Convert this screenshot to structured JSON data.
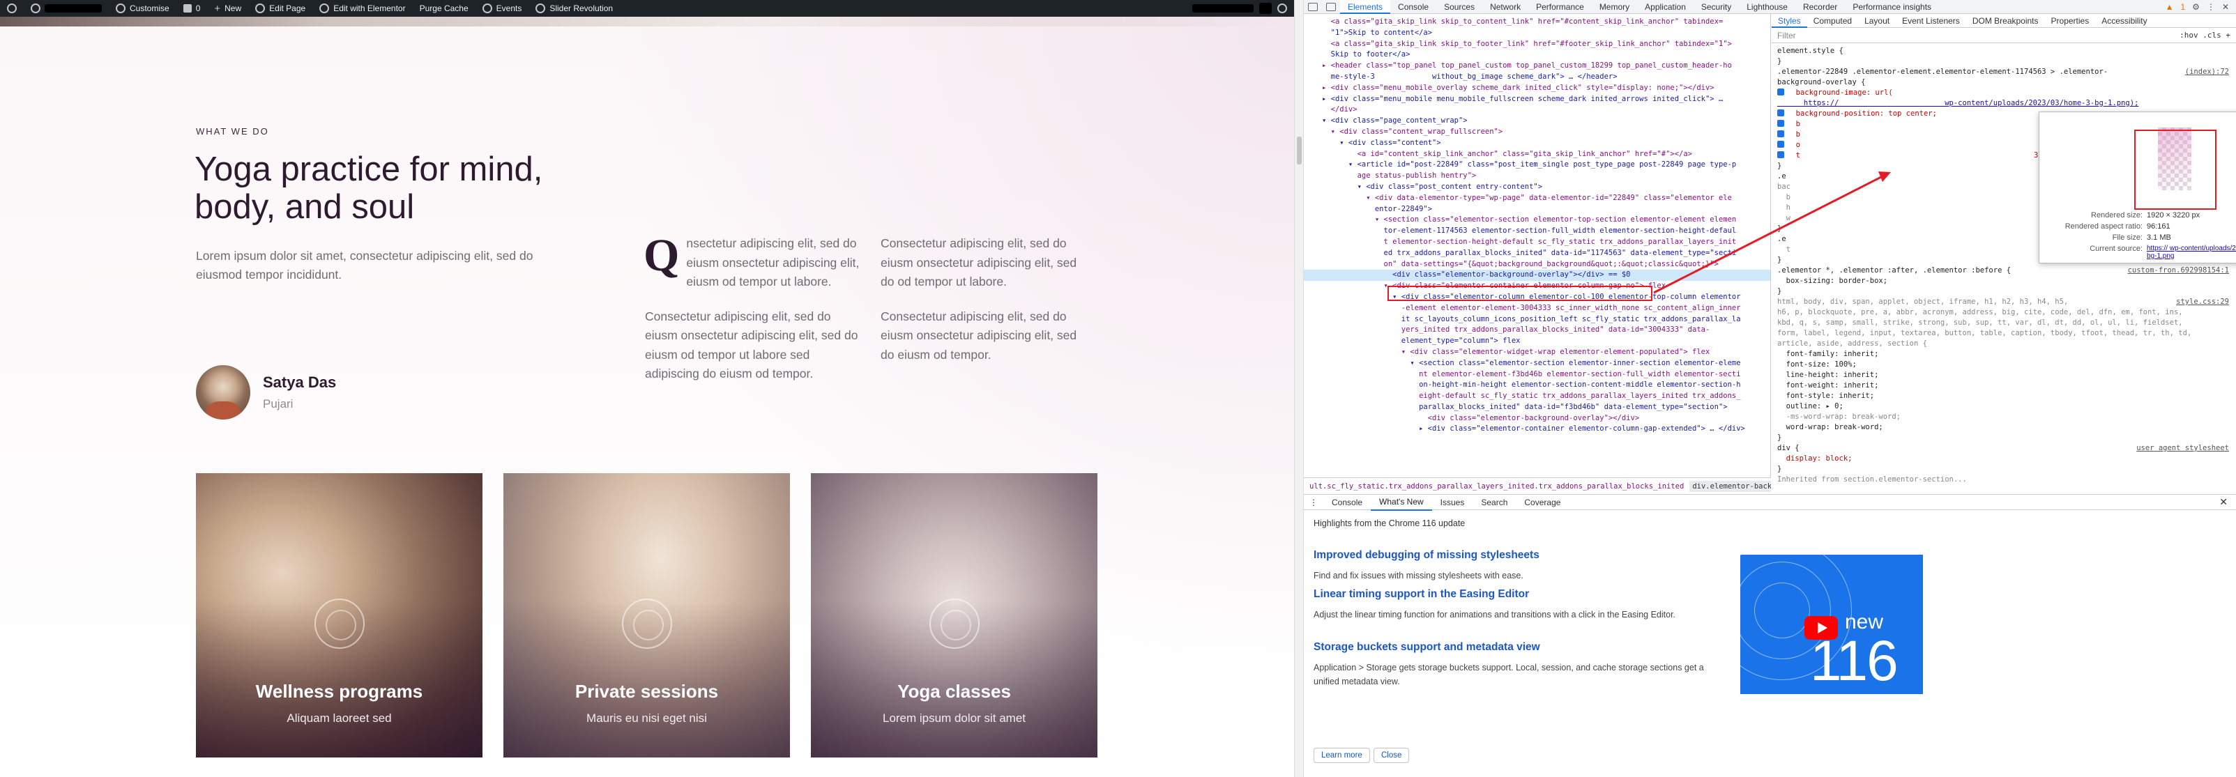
{
  "admin_bar": {
    "items": [
      "Customise",
      "0",
      "New",
      "Edit Page",
      "Edit with Elementor",
      "Purge Cache",
      "Events",
      "Slider Revolution"
    ]
  },
  "site": {
    "kicker": "WHAT WE DO",
    "title": "Yoga practice for mind, body, and soul",
    "lede": "Lorem ipsum dolor sit amet, consectetur adipiscing elit, sed do eiusmod tempor incididunt.",
    "author_name": "Satya Das",
    "author_role": "Pujari",
    "dropcap": "Q",
    "col1_p1": "nsectetur adipiscing elit, sed do eiusm onsectetur adipiscing elit, eiusm od tempor ut labore.",
    "col1_p2": "Consectetur adipiscing elit, sed do eiusm onsectetur adipiscing elit, sed do eiusm od tempor ut labore sed adipiscing  do eiusm od tempor.",
    "col2_p1": "Consectetur adipiscing elit, sed do eiusm onsectetur adipiscing elit, sed do od tempor ut labore.",
    "col2_p2": "Consectetur adipiscing elit, sed do eiusm onsectetur adipiscing elit, sed do eiusm od tempor.",
    "cards": [
      {
        "title": "Wellness programs",
        "subtitle": "Aliquam laoreet sed"
      },
      {
        "title": "Private sessions",
        "subtitle": "Mauris eu nisi eget nisi"
      },
      {
        "title": "Yoga classes",
        "subtitle": "Lorem ipsum dolor sit amet"
      }
    ]
  },
  "devtools": {
    "tabs": [
      "Elements",
      "Console",
      "Sources",
      "Network",
      "Performance",
      "Memory",
      "Application",
      "Security",
      "Lighthouse",
      "Recorder",
      "Performance insights"
    ],
    "active_tab": "Elements",
    "warning_count": "1",
    "dom_lines": [
      "  <a class=\"gita_skip_link skip_to_content_link\" href=\"#content_skip_link_anchor\" tabindex=",
      "  \"1\">Skip to content</a>",
      "  <a class=\"gita_skip_link skip_to_footer_link\" href=\"#footer_skip_link_anchor\" tabindex=\"1\">",
      "  Skip to footer</a>",
      "▸ <header class=\"top_panel top_panel_custom top_panel_custom_18299 top_panel_custom_header-ho",
      "  me-style-3             without_bg_image scheme_dark\"> … </header>",
      "▸ <div class=\"menu_mobile_overlay scheme_dark inited_click\" style=\"display: none;\"></div>",
      "▸ <div class=\"menu_mobile menu_mobile_fullscreen scheme_dark inited_arrows inited_click\"> …",
      "  </div>",
      "▾ <div class=\"page_content_wrap\">",
      "  ▾ <div class=\"content_wrap_fullscreen\">",
      "    ▾ <div class=\"content\">",
      "        <a id=\"content_skip_link_anchor\" class=\"gita_skip_link_anchor\" href=\"#\"></a>",
      "      ▾ <article id=\"post-22849\" class=\"post_item_single post_type_page post-22849 page type-p",
      "        age status-publish hentry\">",
      "        ▾ <div class=\"post_content entry-content\">",
      "          ▾ <div data-elementor-type=\"wp-page\" data-elementor-id=\"22849\" class=\"elementor ele",
      "            entor-22849\">",
      "            ▾ <section class=\"elementor-section elementor-top-section elementor-element elemen",
      "              tor-element-1174563 elementor-section-full_width elementor-section-height-defaul",
      "              t elementor-section-height-default sc_fly_static trx_addons_parallax_layers_init",
      "              ed trx_addons_parallax_blocks_inited\" data-id=\"1174563\" data-element_type=\"secti",
      "              on\" data-settings=\"{&quot;background_background&quot;:&quot;classic&quot;}\">",
      "                <div class=\"elementor-background-overlay\"></div> == $0",
      "              ▾ <div class=\"elementor-container elementor-column-gap-no\"> flex",
      "                ▾ <div class=\"elementor-column elementor-col-100 elementor-top-column elementor",
      "                  -element elementor-element-3004333 sc_inner_width_none sc_content_align_inner",
      "                  it sc_layouts_column_icons_position_left sc_fly_static trx_addons_parallax_la",
      "                  yers_inited trx_addons_parallax_blocks_inited\" data-id=\"3004333\" data-",
      "                  element_type=\"column\"> flex",
      "                  ▾ <div class=\"elementor-widget-wrap elementor-element-populated\"> flex",
      "                    ▾ <section class=\"elementor-section elementor-inner-section elementor-eleme",
      "                      nt elementor-element-f3bd46b elementor-section-full_width elementor-secti",
      "                      on-height-min-height elementor-section-content-middle elementor-section-h",
      "                      eight-default sc_fly_static trx_addons_parallax_layers_inited trx_addons_",
      "                      parallax_blocks_inited\" data-id=\"f3bd46b\" data-element_type=\"section\">",
      "                        <div class=\"elementor-background-overlay\"></div>",
      "                      ▸ <div class=\"elementor-container elementor-column-gap-extended\"> … </div>"
    ],
    "breadcrumbs": [
      "ult.sc_fly_static.trx_addons_parallax_layers_inited.trx_addons_parallax_blocks_inited",
      "div.elementor-background-overlay"
    ],
    "styles_tabs": [
      "Styles",
      "Computed",
      "Layout",
      "Event Listeners",
      "DOM Breakpoints",
      "Properties",
      "Accessibility"
    ],
    "filter_placeholder": "Filter",
    "filter_right": ":hov  .cls  +",
    "style_lines": [
      {
        "t": "element.style {",
        "c": "sel-c"
      },
      {
        "t": "}",
        "c": "sel-c"
      },
      {
        "t": ".elementor-22849 .elementor-element.elementor-element-1174563 > .elementor-",
        "c": "sel-c",
        "src": "(index):72"
      },
      {
        "t": "background-overlay {",
        "c": "sel-c"
      },
      {
        "t": "  background-image: url(",
        "c": "pn",
        "cb": true
      },
      {
        "t": "      https://                        wp-content/uploads/2023/03/home-3-bg-1.png);",
        "c": "lnk"
      },
      {
        "t": "  background-position: top center;",
        "c": "pn",
        "cb": true
      },
      {
        "t": "  b",
        "c": "pn",
        "cb": true
      },
      {
        "t": "  b",
        "c": "pn",
        "cb": true
      },
      {
        "t": "  o",
        "c": "pn",
        "cb": true
      },
      {
        "t": "  t                                                     3s;",
        "c": "pn",
        "cb": true
      },
      {
        "t": "}",
        "c": "sel-c"
      },
      {
        "t": ".e",
        "c": "sel-c",
        "src": "custom-fron.692998154:1"
      },
      {
        "t": "bac",
        "c": "gray"
      },
      {
        "t": "  b",
        "c": "gray"
      },
      {
        "t": "  h",
        "c": "gray"
      },
      {
        "t": "  w",
        "c": "gray"
      },
      {
        "t": "}",
        "c": "sel-c"
      },
      {
        "t": ".e",
        "c": "sel-c",
        "src": "custom-fron.692998154:1"
      },
      {
        "t": "  t",
        "c": "gray"
      },
      {
        "t": "}",
        "c": "sel-c"
      },
      {
        "t": ".elementor *, .elementor :after, .elementor :before {",
        "c": "sel-c",
        "src": "custom-fron.692998154:1"
      },
      {
        "t": "  box-sizing: border-box;",
        "c": "pv"
      },
      {
        "t": "}",
        "c": "sel-c"
      },
      {
        "t": "html, body, div, span, applet, object, iframe, h1, h2, h3, h4, h5,",
        "c": "gray",
        "src": "style.css:29"
      },
      {
        "t": "h6, p, blockquote, pre, a, abbr, acronym, address, big, cite, code, del, dfn, em, font, ins,",
        "c": "gray"
      },
      {
        "t": "kbd, q, s, samp, small, strike, strong, sub, sup, tt, var, dl, dt, dd, ol, ul, li, fieldset,",
        "c": "gray"
      },
      {
        "t": "form, label, legend, input, textarea, button, table, caption, tbody, tfoot, thead, tr, th, td,",
        "c": "gray"
      },
      {
        "t": "article, aside, address, section {",
        "c": "gray"
      },
      {
        "t": "  font-family: inherit;",
        "c": "pv"
      },
      {
        "t": "  font-size: 100%;",
        "c": "pv"
      },
      {
        "t": "  line-height: inherit;",
        "c": "pv"
      },
      {
        "t": "  font-weight: inherit;",
        "c": "pv"
      },
      {
        "t": "  font-style: inherit;",
        "c": "pv"
      },
      {
        "t": "  outline: ▸ 0;",
        "c": "pv"
      },
      {
        "t": "  -ms-word-wrap: break-word;",
        "c": "gray"
      },
      {
        "t": "  word-wrap: break-word;",
        "c": "pv"
      },
      {
        "t": "}",
        "c": "sel-c"
      },
      {
        "t": "div {",
        "c": "sel-c",
        "src": "user agent stylesheet"
      },
      {
        "t": "  display: block;",
        "c": "pn"
      },
      {
        "t": "}",
        "c": "sel-c"
      },
      {
        "t": "Inherited from section.elementor-section...",
        "c": "gray"
      }
    ],
    "tooltip": {
      "rendered_size": "1920 × 3220 px",
      "rendered_ratio": "96:161",
      "file_size": "3.1 MB",
      "current_source": "https://                       wp-content/uploads/2023/03/home-3-bg-1.png",
      "labels": [
        "Rendered size:",
        "Rendered aspect ratio:",
        "File size:",
        "Current source:"
      ]
    },
    "drawer": {
      "tabs": [
        "Console",
        "What's New",
        "Issues",
        "Search",
        "Coverage"
      ],
      "highlight": "Highlights from the Chrome 116 update",
      "items": [
        {
          "title": "Improved debugging of missing stylesheets",
          "body": "Find and fix issues with missing stylesheets with ease."
        },
        {
          "title": "Linear timing support in the Easing Editor",
          "body": "Adjust the linear timing function for animations and transitions with a click in the Easing Editor."
        },
        {
          "title": "Storage buckets support and metadata view",
          "body": "Application > Storage gets storage buckets support. Local, session, and cache storage sections get a unified metadata view."
        }
      ],
      "banner_new": "new",
      "banner_num": "116",
      "learn_more": "Learn more",
      "close": "Close"
    }
  }
}
